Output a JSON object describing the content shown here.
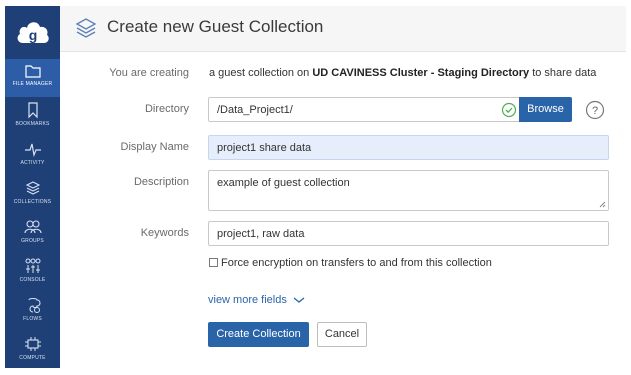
{
  "sidebar": {
    "items": [
      {
        "label": "FILE MANAGER",
        "icon": "folder-icon"
      },
      {
        "label": "BOOKMARKS",
        "icon": "bookmark-icon"
      },
      {
        "label": "ACTIVITY",
        "icon": "activity-icon"
      },
      {
        "label": "COLLECTIONS",
        "icon": "collections-icon"
      },
      {
        "label": "GROUPS",
        "icon": "groups-icon"
      },
      {
        "label": "CONSOLE",
        "icon": "console-icon"
      },
      {
        "label": "FLOWS",
        "icon": "flows-icon"
      },
      {
        "label": "COMPUTE",
        "icon": "compute-icon"
      }
    ]
  },
  "header": {
    "title": "Create new Guest Collection"
  },
  "form": {
    "creating_label": "You are creating",
    "creating_prefix": "a guest collection on ",
    "creating_endpoint": "UD CAVINESS Cluster - Staging Directory",
    "creating_suffix": " to share data",
    "directory_label": "Directory",
    "directory_value": "/Data_Project1/",
    "browse_label": "Browse",
    "display_name_label": "Display Name",
    "display_name_value": "project1 share data",
    "description_label": "Description",
    "description_value": "example of guest collection",
    "keywords_label": "Keywords",
    "keywords_value": "project1, raw data",
    "encryption_label": "Force encryption on transfers to and from this collection",
    "encryption_checked": false,
    "more_fields_label": "view more fields",
    "create_label": "Create Collection",
    "cancel_label": "Cancel"
  },
  "colors": {
    "sidebar_bg": "#1f3f77",
    "sidebar_active": "#2c5da6",
    "primary": "#2a64a8",
    "success": "#4caf50"
  }
}
